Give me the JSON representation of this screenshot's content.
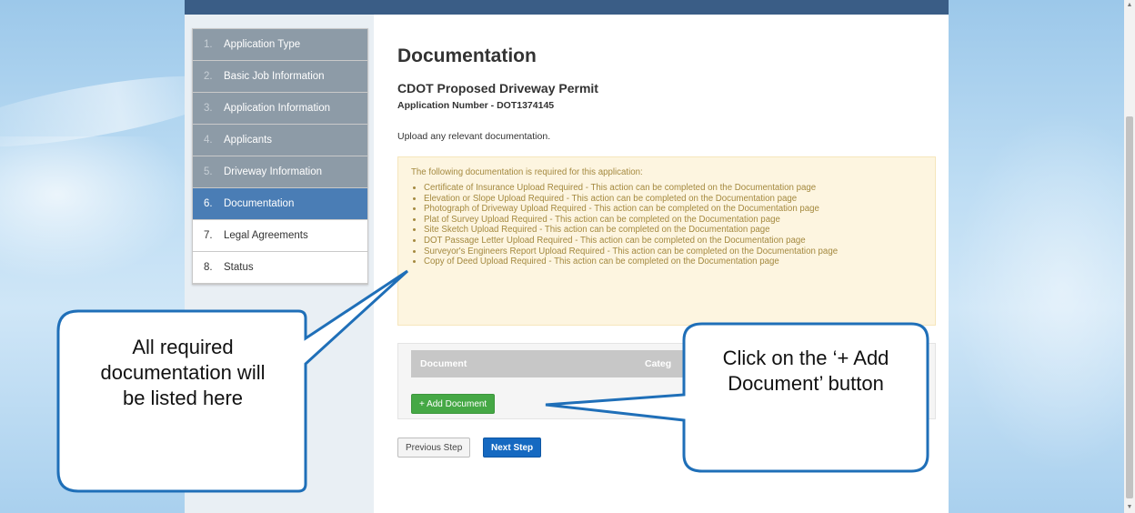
{
  "sidebar": {
    "items": [
      {
        "num": "1.",
        "label": "Application Type",
        "state": "done"
      },
      {
        "num": "2.",
        "label": "Basic Job Information",
        "state": "done"
      },
      {
        "num": "3.",
        "label": "Application Information",
        "state": "done"
      },
      {
        "num": "4.",
        "label": "Applicants",
        "state": "done"
      },
      {
        "num": "5.",
        "label": "Driveway Information",
        "state": "done"
      },
      {
        "num": "6.",
        "label": "Documentation",
        "state": "active"
      },
      {
        "num": "7.",
        "label": "Legal Agreements",
        "state": "todo"
      },
      {
        "num": "8.",
        "label": "Status",
        "state": "todo"
      }
    ]
  },
  "main": {
    "title": "Documentation",
    "subtitle": "CDOT Proposed Driveway Permit",
    "app_number": "Application Number - DOT1374145",
    "intro": "Upload any relevant documentation.",
    "required": {
      "title": "The following documentation is required for this application:",
      "items": [
        "Certificate of Insurance Upload Required - This action can be completed on the Documentation page",
        "Elevation or Slope Upload Required - This action can be completed on the Documentation page",
        "Photograph of Driveway Upload Required - This action can be completed on the Documentation page",
        "Plat of Survey Upload Required - This action can be completed on the Documentation page",
        "Site Sketch Upload Required - This action can be completed on the Documentation page",
        "DOT Passage Letter Upload Required - This action can be completed on the Documentation page",
        "Surveyor's Engineers Report Upload Required - This action can be completed on the Documentation page",
        "Copy of Deed Upload Required - This action can be completed on the Documentation page"
      ]
    },
    "table": {
      "col_document": "Document",
      "col_category": "Categ"
    },
    "add_button": "+ Add Document",
    "prev_button": "Previous Step",
    "next_button": "Next Step"
  },
  "callouts": {
    "left": "All required documentation will be listed here",
    "right": "Click on the ‘+ Add Document’ button"
  },
  "colors": {
    "accent": "#4a7db5",
    "callout_border": "#1f6fb8",
    "add_button": "#45a845",
    "next_button": "#1569c1"
  }
}
